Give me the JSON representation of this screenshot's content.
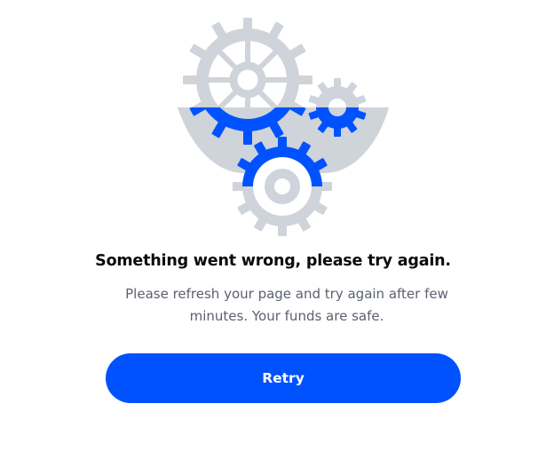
{
  "illustration": {
    "icon": "gears-illustration-icon",
    "colors": {
      "gray": "#cfd3da",
      "blue": "#0052ff"
    }
  },
  "error": {
    "title": "Something went wrong, please try again.",
    "message": "Please refresh your page and try again after few minutes. Your funds are safe."
  },
  "actions": {
    "retry_label": "Retry"
  }
}
